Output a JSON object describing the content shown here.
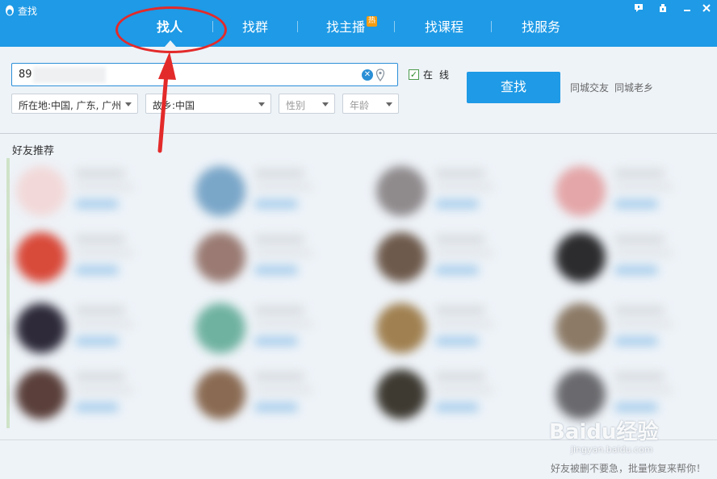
{
  "window": {
    "title": "查找",
    "controls": [
      "feedback-icon",
      "skin-icon",
      "minimize-icon",
      "close-icon"
    ]
  },
  "tabs": [
    {
      "label": "找人",
      "active": true
    },
    {
      "label": "找群",
      "active": false
    },
    {
      "label": "找主播",
      "badge": "热",
      "active": false
    },
    {
      "label": "找课程",
      "active": false
    },
    {
      "label": "找服务",
      "active": false
    }
  ],
  "search": {
    "value": "89",
    "online_label": "在线",
    "online_checked": true,
    "find_button": "查找"
  },
  "filters": {
    "location": "所在地:中国, 广东, 广州",
    "hometown": "故乡:中国",
    "gender": "性别",
    "age": "年龄"
  },
  "links": {
    "same_city_friends": "同城交友",
    "same_city_hometown": "同城老乡"
  },
  "section": {
    "recommend_title": "好友推荐"
  },
  "watermark": {
    "logo": "Baidu经验",
    "url": "jingyan.baidu.com"
  },
  "footer": {
    "text": "好友被删不要急，批量恢复来帮你！"
  },
  "colors": {
    "header": "#1e9ae6",
    "button": "#1e9ae6",
    "annotation": "#e32a2a",
    "background": "#eef3f8"
  }
}
